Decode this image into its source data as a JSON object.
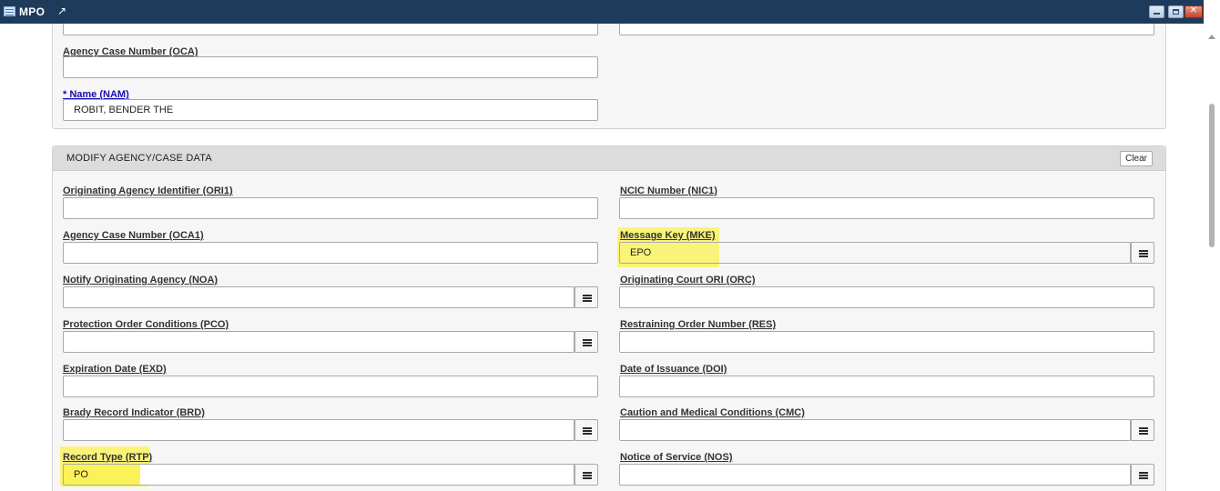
{
  "window": {
    "title": "MPO",
    "popout_icon": "external-link-icon",
    "controls": [
      "minimize-icon",
      "maximize-icon",
      "close-icon"
    ]
  },
  "top_section": {
    "fields": {
      "oca": {
        "label": "Agency Case Number (OCA)",
        "value": ""
      },
      "nam": {
        "label": "* Name (NAM)",
        "value": "ROBIT, BENDER THE",
        "required": true
      }
    }
  },
  "modify_section": {
    "title": "MODIFY AGENCY/CASE DATA",
    "clear_label": "Clear",
    "fields": {
      "ori1": {
        "label": "Originating Agency Identifier (ORI1)",
        "value": ""
      },
      "nic1": {
        "label": "NCIC Number (NIC1)",
        "value": ""
      },
      "oca1": {
        "label": "Agency Case Number (OCA1)",
        "value": ""
      },
      "mke": {
        "label": "Message Key (MKE)",
        "value": "EPO",
        "highlighted": true
      },
      "noa": {
        "label": "Notify Originating Agency (NOA)",
        "value": ""
      },
      "orc": {
        "label": "Originating Court ORI (ORC)",
        "value": ""
      },
      "pco": {
        "label": "Protection Order Conditions (PCO)",
        "value": ""
      },
      "res": {
        "label": "Restraining Order Number (RES)",
        "value": ""
      },
      "exd": {
        "label": "Expiration Date (EXD)",
        "value": ""
      },
      "doi": {
        "label": "Date of Issuance (DOI)",
        "value": ""
      },
      "brd": {
        "label": "Brady Record Indicator (BRD)",
        "value": ""
      },
      "cmc": {
        "label": "Caution and Medical Conditions (CMC)",
        "value": ""
      },
      "rtp": {
        "label": "Record Type (RTP)",
        "value": "PO",
        "highlighted": true
      },
      "nos": {
        "label": "Notice of Service (NOS)",
        "value": ""
      }
    }
  },
  "colors": {
    "titlebar": "#1f3b5c",
    "highlight": "#fbf24f",
    "required_label": "#1a0dab",
    "panel_header": "#dcdcdc"
  },
  "icons": {
    "list_button": "list-icon",
    "scroll_up": "arrow-up-icon"
  }
}
